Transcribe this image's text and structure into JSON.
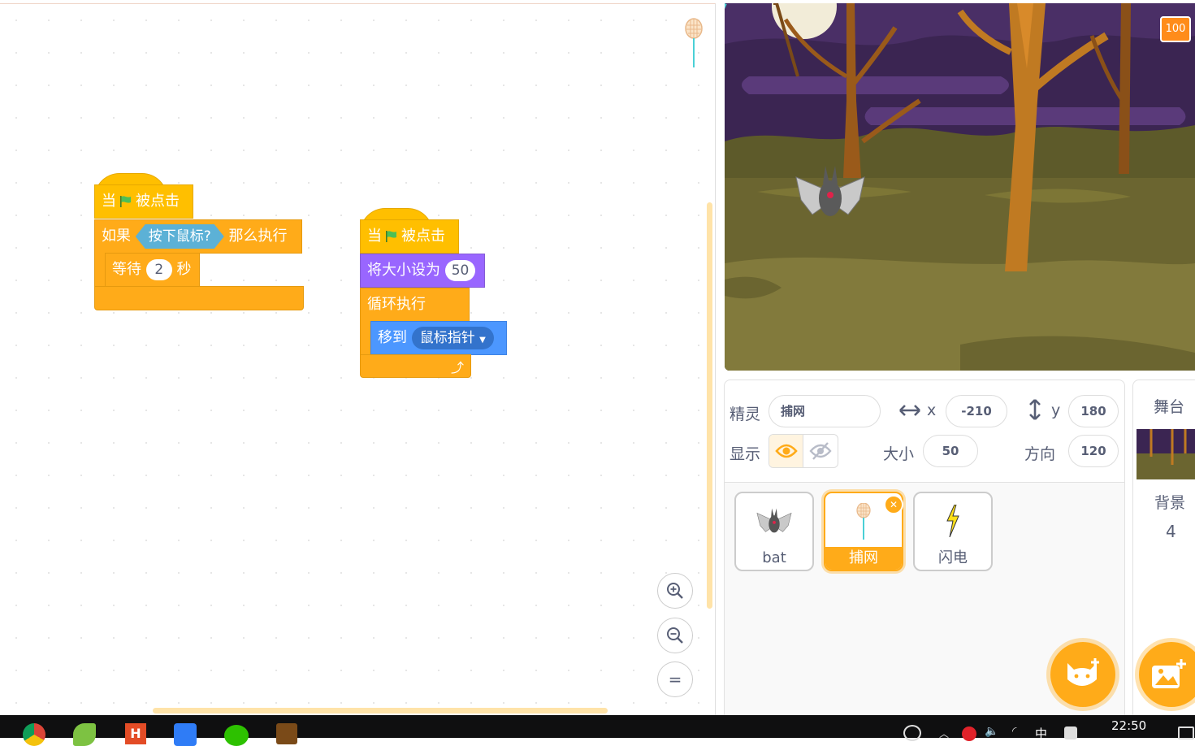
{
  "code_area": {
    "script1": {
      "hat_when": "当",
      "hat_clicked": "被点击",
      "if_label": "如果",
      "if_condition": "按下鼠标?",
      "if_then": "那么执行",
      "wait_label": "等待",
      "wait_value": "2",
      "wait_unit": "秒"
    },
    "script2": {
      "hat_when": "当",
      "hat_clicked": "被点击",
      "set_size_label": "将大小设为",
      "set_size_value": "50",
      "forever_label": "循环执行",
      "goto_label": "移到",
      "goto_target": "鼠标指针"
    },
    "zoom_in": "+",
    "zoom_out": "−",
    "zoom_reset": "="
  },
  "stage": {
    "badge": "100"
  },
  "sprite_info": {
    "sprite_label": "精灵",
    "sprite_name": "捕网",
    "x_label": "x",
    "x_value": "-210",
    "y_label": "y",
    "y_value": "180",
    "show_label": "显示",
    "size_label": "大小",
    "size_value": "50",
    "direction_label": "方向",
    "direction_value": "120"
  },
  "sprites": [
    {
      "name": "bat",
      "selected": false
    },
    {
      "name": "捕网",
      "selected": true
    },
    {
      "name": "闪电",
      "selected": false
    }
  ],
  "stage_panel": {
    "title": "舞台",
    "backdrop_label": "背景",
    "backdrop_count": "4"
  },
  "taskbar": {
    "time": "22:50",
    "ime_label": "中"
  },
  "colors": {
    "events": "#ffbf00",
    "control": "#ffab19",
    "looks": "#9966ff",
    "motion": "#4c97ff",
    "sensing": "#5cb1d6",
    "accent": "#ffab19"
  }
}
